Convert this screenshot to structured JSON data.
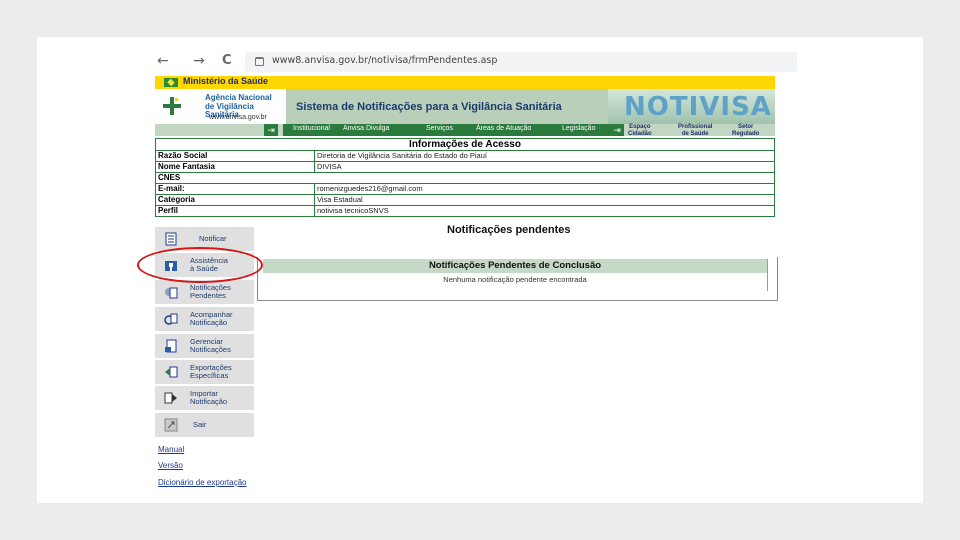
{
  "browser": {
    "back_glyph": "←",
    "forward_glyph": "→",
    "reload_glyph": "C",
    "url": "www8.anvisa.gov.br/notivisa/frmPendentes.asp"
  },
  "ministry": {
    "label": "Ministério da Saúde"
  },
  "logo": {
    "name_line1": "Agência Nacional",
    "name_line2": "de Vigilância Sanitária",
    "url": "www.anvisa.gov.br"
  },
  "header": {
    "system_title": "Sistema de Notificações para a Vigilância Sanitária",
    "brand": "NOTIVISA"
  },
  "menu": {
    "items": [
      "Institucional",
      "Anvisa Divulga",
      "Serviços",
      "Áreas de Atuação",
      "Legislação"
    ],
    "right_items": [
      {
        "line1": "Espaço",
        "line2": "Cidadão"
      },
      {
        "line1": "Profissional",
        "line2": "de Saúde"
      },
      {
        "line1": "Setor",
        "line2": "Regulado"
      }
    ]
  },
  "access_info": {
    "title": "Informações de Acesso",
    "rows": [
      {
        "label": "Razão Social",
        "value": "Diretoria de Vigilância Sanitária do Estado do Piauí"
      },
      {
        "label": "Nome Fantasia",
        "value": "DIVISA"
      },
      {
        "label": "CNES",
        "value": ""
      },
      {
        "label": "E-mail:",
        "value": "romenizguedes216@gmail.com"
      },
      {
        "label": "Categoria",
        "value": "Visa Estadual"
      },
      {
        "label": "Perfil",
        "value": "notivisa tecnicoSNVS"
      }
    ]
  },
  "sidebar": {
    "items": [
      {
        "line1": "Notificar",
        "line2": ""
      },
      {
        "line1": "Assistência",
        "line2": "à Saúde"
      },
      {
        "line1": "Notificações",
        "line2": "Pendentes"
      },
      {
        "line1": "Acompanhar",
        "line2": "Notificação"
      },
      {
        "line1": "Gerenciar",
        "line2": "Notificações"
      },
      {
        "line1": "Exportações",
        "line2": "Específicas"
      },
      {
        "line1": "Importar",
        "line2": "Notificação"
      },
      {
        "line1": "Sair",
        "line2": ""
      }
    ],
    "links": [
      "Manual",
      "Versão",
      "Dicionário de exportação"
    ]
  },
  "notifications": {
    "title": "Notificações pendentes",
    "section_title": "Notificações Pendentes de Conclusão",
    "empty_message": "Nenhuma notificação pendente encontrada"
  },
  "colors": {
    "ministry_bar": "#ffd700",
    "menu_dark": "#2b7a3e",
    "highlight_ring": "#d41717",
    "header_green": "#b9cfb9"
  }
}
